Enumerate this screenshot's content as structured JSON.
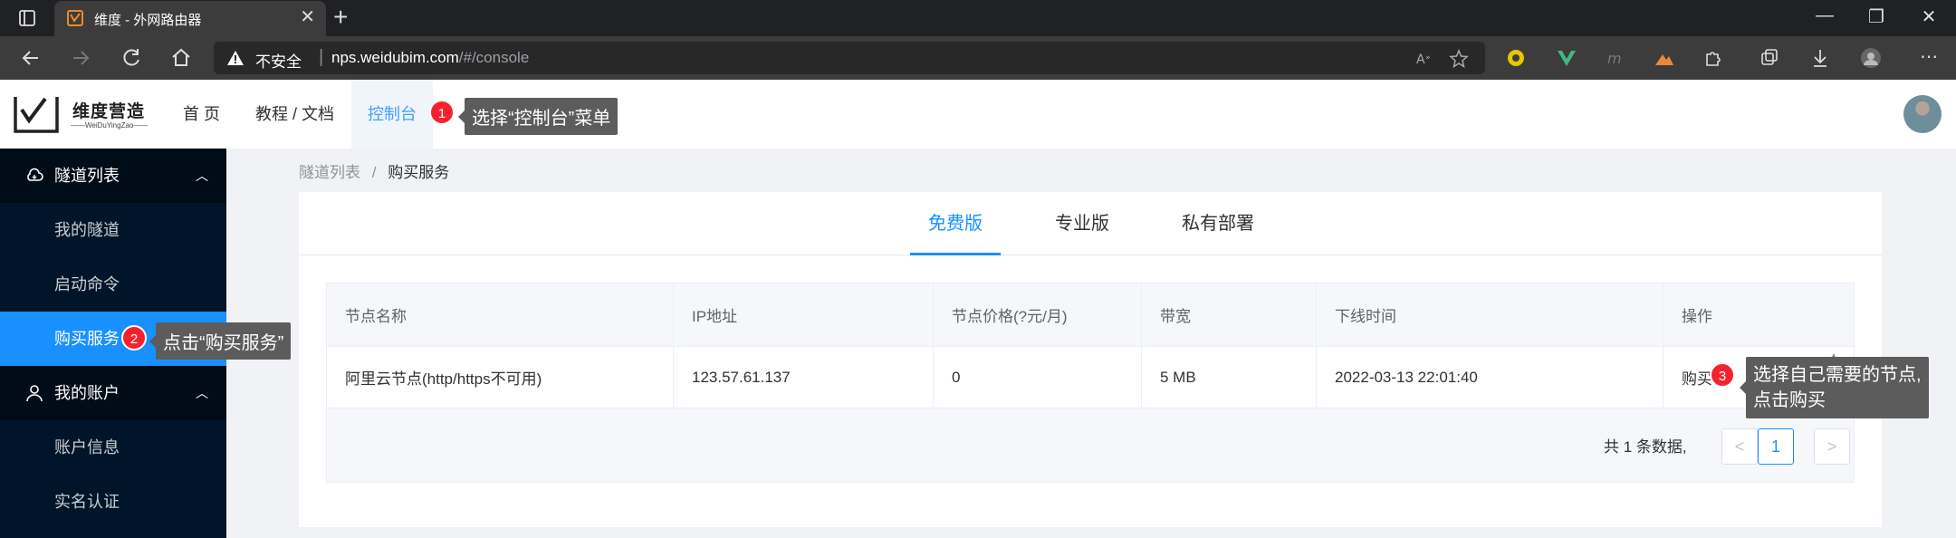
{
  "browser": {
    "tab_title": "维度 - 外网路由器",
    "insecure_label": "不安全",
    "url_host": "nps.weidubim.com",
    "url_path": "/#/console"
  },
  "header": {
    "logo_text": "维度营造",
    "logo_sub": "——WeiDuYingZao——",
    "nav": [
      "首 页",
      "教程 / 文档",
      "控制台"
    ]
  },
  "annotations": [
    {
      "number": "1",
      "text": "选择“控制台”菜单"
    },
    {
      "number": "2",
      "text": "点击“购买服务”"
    },
    {
      "number": "3",
      "text_line1": "选择自己需要的节点,",
      "text_line2": "点击购买"
    }
  ],
  "sidebar": {
    "group1": "隧道列表",
    "group1_items": [
      "我的隧道",
      "启动命令",
      "购买服务"
    ],
    "group2": "我的账户",
    "group2_items": [
      "账户信息",
      "实名认证"
    ]
  },
  "breadcrumb": {
    "parent": "隧道列表",
    "separator": "/",
    "current": "购买服务"
  },
  "plan_tabs": [
    "免费版",
    "专业版",
    "私有部署"
  ],
  "table": {
    "headers": [
      "节点名称",
      "IP地址",
      "节点价格(?元/月)",
      "带宽",
      "下线时间",
      "操作"
    ],
    "rows": [
      [
        "阿里云节点(http/https不可用)",
        "123.57.61.137",
        "0",
        "5 MB",
        "2022-03-13 22:01:40",
        "购买"
      ]
    ]
  },
  "pagination": {
    "total_text": "共 1 条数据,",
    "prev": "<",
    "page": "1",
    "next": ">"
  },
  "colors": {
    "primary": "#1890ff",
    "sidebar_bg": "#001529",
    "badge": "#f5222d",
    "tooltip": "#5c5c5c"
  }
}
